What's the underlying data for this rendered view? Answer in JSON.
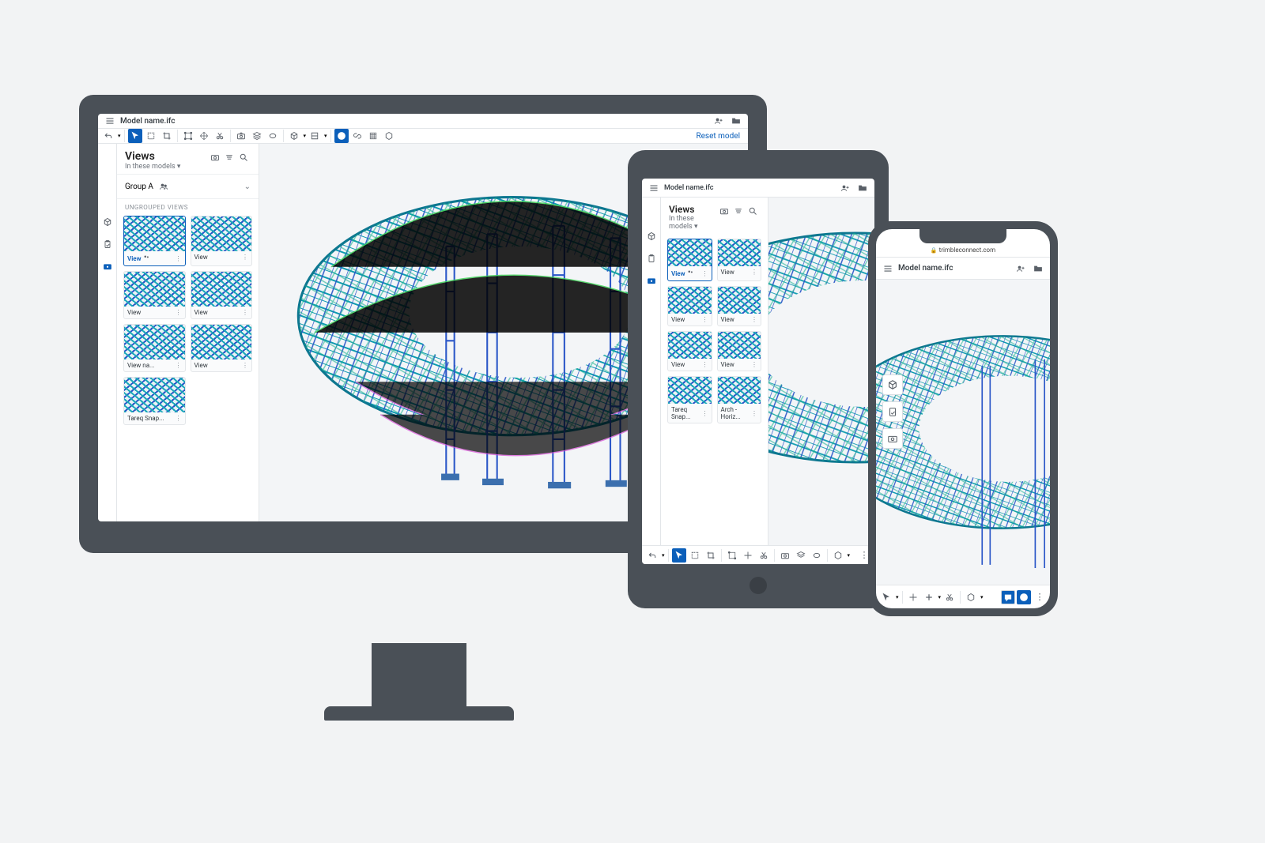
{
  "model_name": "Model name.ifc",
  "reset_label": "Reset model",
  "toolbar_icons": [
    "undo-icon",
    "select-icon",
    "marquee-icon",
    "crop-icon",
    "transform-icon",
    "pan-icon",
    "cut-icon",
    "camera-icon",
    "layers-icon",
    "ellipse-icon",
    "cube-icon",
    "clip-icon",
    "help-icon",
    "link-icon",
    "grid-icon",
    "box-icon"
  ],
  "leftrail": [
    "cube-icon",
    "clipboard-icon",
    "camera-icon"
  ],
  "panel": {
    "title": "Views",
    "subtitle": "In these models ▾",
    "head_icons": [
      "camera-icon",
      "sort-icon",
      "search-icon"
    ],
    "group_row": {
      "label": "Group A",
      "people_icon": "people-icon"
    },
    "section": "UNGROUPED VIEWS",
    "thumbs": [
      {
        "label": "View",
        "selected": true,
        "people": true
      },
      {
        "label": "View"
      },
      {
        "label": "View"
      },
      {
        "label": "View"
      },
      {
        "label": "View na..."
      },
      {
        "label": "View"
      },
      {
        "label": "Tareq Snap..."
      }
    ]
  },
  "tablet_thumbs": [
    {
      "label": "View",
      "selected": true,
      "people": true
    },
    {
      "label": "View"
    },
    {
      "label": "View"
    },
    {
      "label": "View"
    },
    {
      "label": "View"
    },
    {
      "label": "View"
    },
    {
      "label": "Tareq Snap..."
    },
    {
      "label": "Arch - Horiz..."
    }
  ],
  "phone": {
    "url": "trimbleconnect.com",
    "bottombar": [
      "select-icon",
      "pan-icon",
      "plus-icon",
      "cut-icon",
      "cube-icon",
      "message-icon",
      "help-icon",
      "more-icon"
    ]
  }
}
